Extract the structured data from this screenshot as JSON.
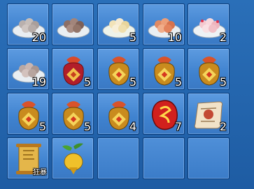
{
  "inventory": {
    "slots": [
      {
        "item": "dumpling-plate-grey-icon",
        "count": "20"
      },
      {
        "item": "dumpling-plate-brown-icon",
        "count": ""
      },
      {
        "item": "dumpling-plate-cream-icon",
        "count": "5"
      },
      {
        "item": "dumpling-plate-orange-icon",
        "count": "10"
      },
      {
        "item": "dumpling-plate-pink-icon",
        "count": "2"
      },
      {
        "item": "dumpling-plate-grey-icon",
        "count": "19"
      },
      {
        "item": "lucky-bag-red-icon",
        "count": "5"
      },
      {
        "item": "lucky-bag-gold-icon",
        "count": "5"
      },
      {
        "item": "lucky-bag-gold-icon",
        "count": "5"
      },
      {
        "item": "lucky-bag-gold-icon",
        "count": "5"
      },
      {
        "item": "lucky-bag-gold-icon",
        "count": "5"
      },
      {
        "item": "lucky-bag-gold-icon",
        "count": "5"
      },
      {
        "item": "lucky-bag-gold-icon",
        "count": "4"
      },
      {
        "item": "red-talisman-stone-icon",
        "count": "7"
      },
      {
        "item": "recipe-scroll-icon",
        "count": "2"
      },
      {
        "item": "golden-scroll-icon",
        "label": "狂暴"
      },
      {
        "item": "golden-fruit-icon",
        "count": ""
      },
      {
        "item": "",
        "count": ""
      },
      {
        "item": "",
        "count": ""
      },
      {
        "item": "",
        "count": ""
      }
    ]
  },
  "colors": {
    "panel": "#2a6fb8",
    "slot": "#4a8bd6",
    "slot_border": "#0d3d79",
    "count_text": "#ffffff"
  }
}
